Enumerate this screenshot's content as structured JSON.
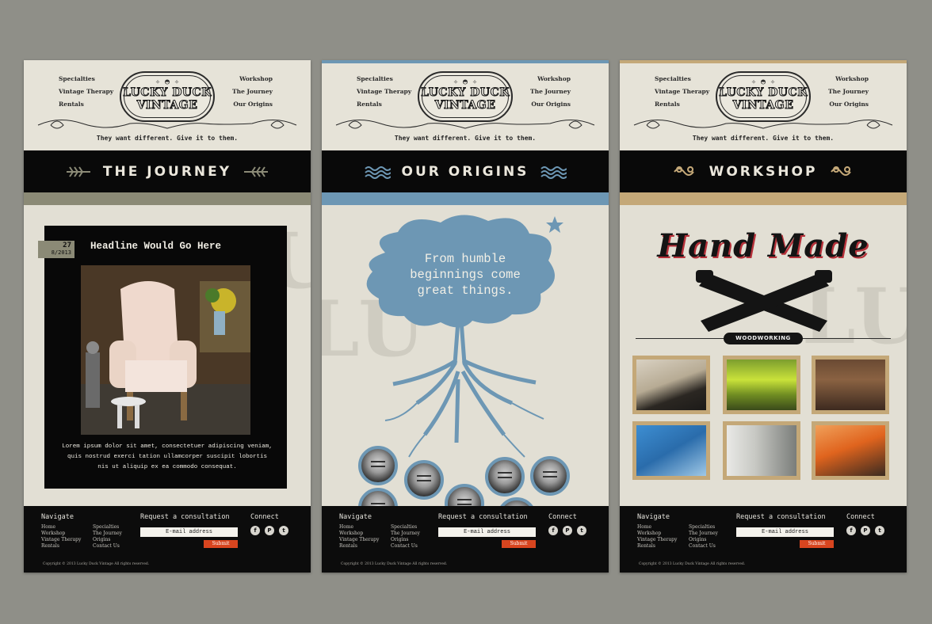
{
  "header": {
    "nav_left": [
      "Specialties",
      "Vintage Therapy",
      "Rentals"
    ],
    "nav_right": [
      "Workshop",
      "The Journey",
      "Our Origins"
    ],
    "logo_line1": "LUCKY DUCK",
    "logo_line2": "VINTAGE",
    "tagline": "They want different. Give it to them."
  },
  "pages": {
    "journey": {
      "title": "THE JOURNEY",
      "accent_color": "#8b8a76",
      "post": {
        "date_day": "27",
        "date_full": "8/2013",
        "headline": "Headline Would Go Here",
        "body": "Lorem ipsum dolor sit amet, consectetuer adipiscing veniam, quis nostrud exerci tation ullamcorper suscipit lobortis nis ut aliquip ex ea commodo consequat."
      }
    },
    "origins": {
      "title": "OUR ORIGINS",
      "accent_color": "#6d97b4",
      "tree_text": [
        "From humble",
        "beginnings come",
        "great things."
      ]
    },
    "workshop": {
      "title": "WORKSHOP",
      "accent_color": "#c4a878",
      "hero_title": "Hand Made",
      "hero_label": "WOODWORKING"
    }
  },
  "footer": {
    "navigate_label": "Navigate",
    "nav_col1": [
      "Home",
      "Workshop",
      "Vintage Therapy",
      "Rentals"
    ],
    "nav_col2": [
      "Specialties",
      "The Journey",
      "Origins",
      "Contact Us"
    ],
    "request_label": "Request a consultation",
    "email_placeholder": "E-mail address",
    "submit_label": "Submit",
    "connect_label": "Connect",
    "social_icons": [
      "facebook-icon",
      "pinterest-icon",
      "twitter-icon"
    ],
    "copyright": "Copyright © 2013 Lucky Duck Vintage All rights reserved."
  }
}
